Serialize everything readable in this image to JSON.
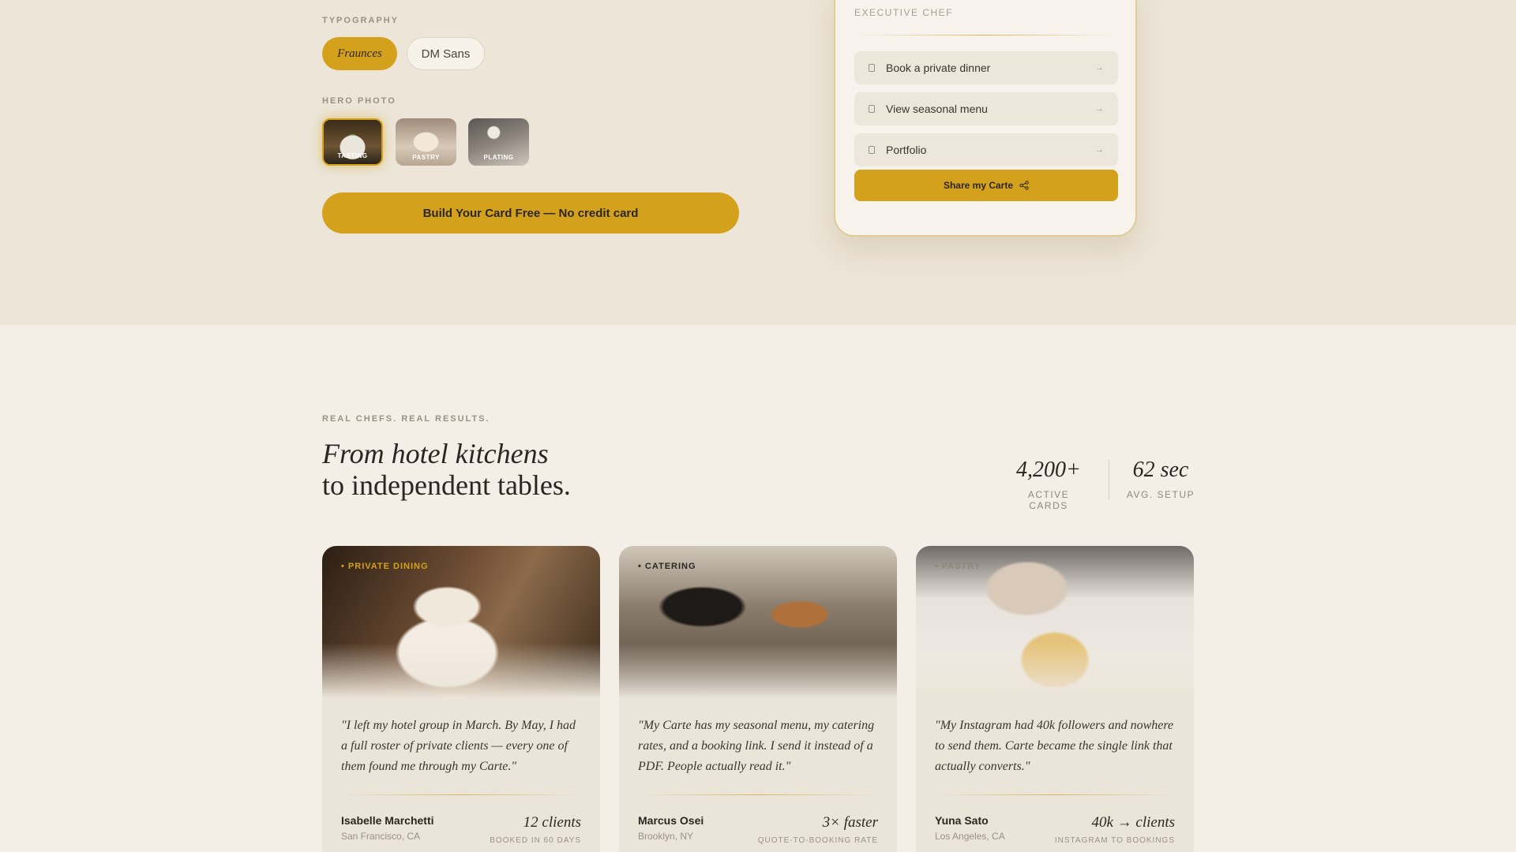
{
  "builder": {
    "typography_label": "TYPOGRAPHY",
    "fonts": [
      "Fraunces",
      "DM Sans"
    ],
    "selected_font": "Fraunces",
    "hero_photo_label": "HERO PHOTO",
    "hero_photos": [
      "TASTING",
      "PASTRY",
      "PLATING"
    ],
    "selected_hero_photo": "TASTING",
    "cta_label": "Build Your Card Free — No credit card"
  },
  "preview_card": {
    "role": "EXECUTIVE CHEF",
    "links": [
      {
        "label": "Book a private dinner",
        "icon": "bookmark-icon"
      },
      {
        "label": "View seasonal menu",
        "icon": "bookmark-icon"
      },
      {
        "label": "Portfolio",
        "icon": "bookmark-icon"
      }
    ],
    "share_label": "Share my Carte",
    "share_icon": "share-icon"
  },
  "testimonials": {
    "eyebrow": "REAL CHEFS. REAL RESULTS.",
    "headline_italic": "From hotel kitchens",
    "headline_regular": "to independent tables.",
    "stats": [
      {
        "value": "4,200+",
        "label": "ACTIVE CARDS"
      },
      {
        "value": "62 sec",
        "label": "AVG. SETUP"
      }
    ],
    "cards": [
      {
        "tag": "• PRIVATE DINING",
        "quote": "\"I left my hotel group in March. By May, I had a full roster of private clients — every one of them found me through my Carte.\"",
        "name": "Isabelle Marchetti",
        "location": "San Francisco, CA",
        "metric_value": "12 clients",
        "metric_label": "BOOKED IN 60 DAYS"
      },
      {
        "tag": "• CATERING",
        "quote": "\"My Carte has my seasonal menu, my catering rates, and a booking link. I send it instead of a PDF. People actually read it.\"",
        "name": "Marcus Osei",
        "location": "Brooklyn, NY",
        "metric_value": "3× faster",
        "metric_label": "QUOTE-TO-BOOKING RATE"
      },
      {
        "tag": "• PASTRY",
        "quote": "\"My Instagram had 40k followers and nowhere to send them. Carte became the single link that actually converts.\"",
        "name": "Yuna Sato",
        "location": "Los Angeles, CA",
        "metric_value": "40k → clients",
        "metric_label": "INSTAGRAM TO BOOKINGS"
      }
    ]
  },
  "colors": {
    "accent": "#d4a11c",
    "top_band": "#ece5d8",
    "page_bg": "#f3efe7",
    "card_bg": "#ebe4d8"
  }
}
